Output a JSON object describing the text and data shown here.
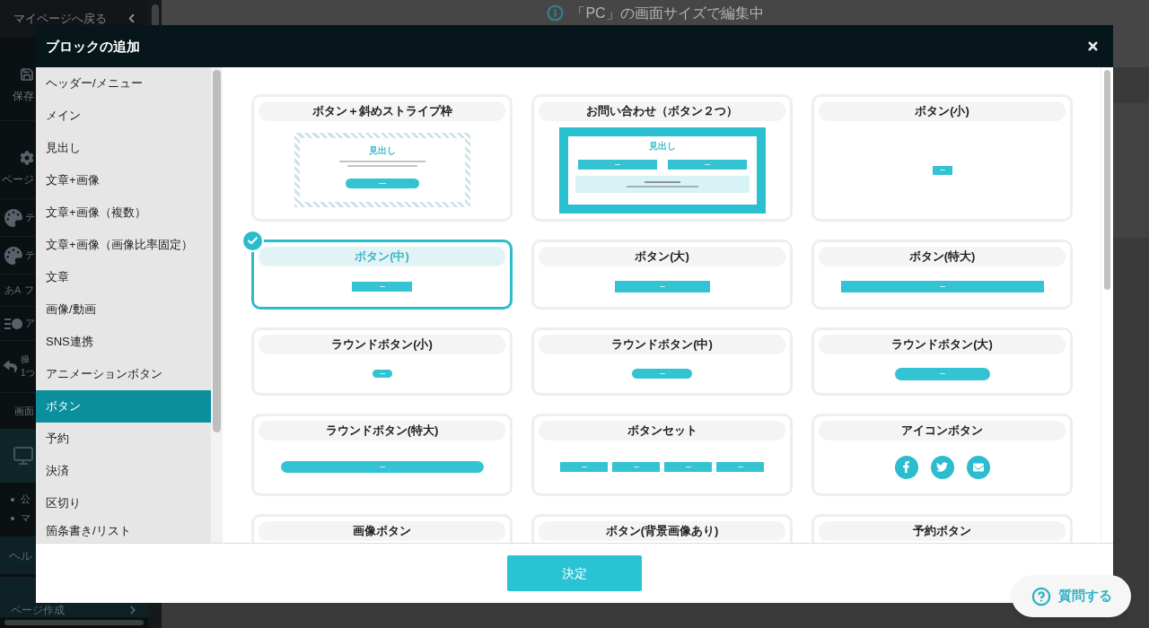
{
  "background": {
    "sidebar": {
      "back_link": "マイページへ戻る",
      "items": [
        {
          "kind": "stacked",
          "label": "保存"
        },
        {
          "kind": "stacked",
          "label": "ページ"
        },
        {
          "kind": "inline",
          "label": "テ"
        },
        {
          "kind": "inline",
          "label": "テ"
        },
        {
          "kind": "glyph",
          "glyph": "あA",
          "label": "フ"
        },
        {
          "kind": "inline",
          "label": "ア"
        },
        {
          "kind": "two_line",
          "lines": [
            "操",
            "1つ"
          ]
        },
        {
          "kind": "plain",
          "label": "画面"
        },
        {
          "kind": "device"
        },
        {
          "kind": "bullets",
          "bullets": [
            "公",
            "マ"
          ]
        },
        {
          "kind": "band",
          "label": "ヘル"
        },
        {
          "kind": "band_link",
          "label": "ページ作成"
        }
      ]
    },
    "edit_notice": "「PC」の画面サイズで編集中"
  },
  "dialog": {
    "title": "ブロックの追加",
    "categories": [
      {
        "label": "ヘッダー/メニュー",
        "selected": false
      },
      {
        "label": "メイン",
        "selected": false
      },
      {
        "label": "見出し",
        "selected": false
      },
      {
        "label": "文章+画像",
        "selected": false
      },
      {
        "label": "文章+画像（複数）",
        "selected": false
      },
      {
        "label": "文章+画像（画像比率固定）",
        "selected": false
      },
      {
        "label": "文章",
        "selected": false
      },
      {
        "label": "画像/動画",
        "selected": false
      },
      {
        "label": "SNS連携",
        "selected": false
      },
      {
        "label": "アニメーションボタン",
        "selected": false
      },
      {
        "label": "ボタン",
        "selected": true
      },
      {
        "label": "予約",
        "selected": false
      },
      {
        "label": "決済",
        "selected": false
      },
      {
        "label": "区切り",
        "selected": false
      },
      {
        "label": "箇条書き/リスト",
        "selected": false
      }
    ],
    "blocks": [
      {
        "title": "ボタン＋斜めストライプ枠",
        "selected": false,
        "preview": {
          "kind": "stripe_frame",
          "heading": "見出し"
        }
      },
      {
        "title": "お問い合わせ（ボタン２つ）",
        "selected": false,
        "preview": {
          "kind": "contact",
          "heading": "見出し"
        }
      },
      {
        "title": "ボタン(小)",
        "selected": false,
        "preview": {
          "kind": "small_button"
        }
      },
      {
        "title": "ボタン(中)",
        "selected": true,
        "preview": {
          "kind": "medium_button"
        }
      },
      {
        "title": "ボタン(大)",
        "selected": false,
        "preview": {
          "kind": "large_button"
        }
      },
      {
        "title": "ボタン(特大)",
        "selected": false,
        "preview": {
          "kind": "xlarge_button"
        }
      },
      {
        "title": "ラウンドボタン(小)",
        "selected": false,
        "preview": {
          "kind": "small_round_button"
        }
      },
      {
        "title": "ラウンドボタン(中)",
        "selected": false,
        "preview": {
          "kind": "medium_round_button"
        }
      },
      {
        "title": "ラウンドボタン(大)",
        "selected": false,
        "preview": {
          "kind": "large_round_button"
        }
      },
      {
        "title": "ラウンドボタン(特大)",
        "selected": false,
        "preview": {
          "kind": "xlarge_round_button"
        }
      },
      {
        "title": "ボタンセット",
        "selected": false,
        "preview": {
          "kind": "button_set"
        }
      },
      {
        "title": "アイコンボタン",
        "selected": false,
        "preview": {
          "kind": "icon_buttons"
        }
      },
      {
        "title": "画像ボタン",
        "selected": false
      },
      {
        "title": "ボタン(背景画像あり)",
        "selected": false
      },
      {
        "title": "予約ボタン",
        "selected": false
      }
    ],
    "confirm_button": "決定"
  },
  "help_button": "質問する"
}
